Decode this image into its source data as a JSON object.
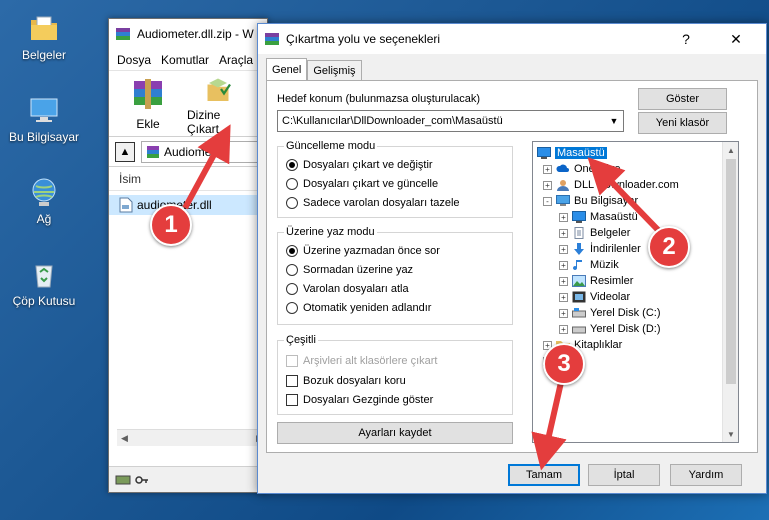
{
  "desktop": {
    "icons": [
      {
        "label": "Belgeler",
        "icon": "documents-folder-icon"
      },
      {
        "label": "Bu Bilgisayar",
        "icon": "computer-icon"
      },
      {
        "label": "Ağ",
        "icon": "network-icon"
      },
      {
        "label": "Çöp Kutusu",
        "icon": "recycle-bin-icon"
      }
    ]
  },
  "winrar": {
    "title": "Audiometer.dll.zip - W",
    "menu": [
      "Dosya",
      "Komutlar",
      "Araçla"
    ],
    "toolbar": {
      "add_label": "Ekle",
      "extract_label": "Dizine Çıkart"
    },
    "path": "Audiometer",
    "list_header": "İsim",
    "file_name": "audiometer.dll"
  },
  "dialog": {
    "title": "Çıkartma yolu ve seçenekleri",
    "close": "✕",
    "help": "?",
    "tabs": [
      {
        "label": "Genel",
        "active": true
      },
      {
        "label": "Gelişmiş",
        "active": false
      }
    ],
    "destination_label": "Hedef konum (bulunmazsa oluşturulacak)",
    "destination_value": "C:\\Kullanıcılar\\DllDownloader_com\\Masaüstü",
    "show_button": "Göster",
    "new_folder_button": "Yeni klasör",
    "update_mode": {
      "title": "Güncelleme modu",
      "options": [
        {
          "label": "Dosyaları çıkart ve değiştir",
          "selected": true
        },
        {
          "label": "Dosyaları çıkart ve güncelle",
          "selected": false
        },
        {
          "label": "Sadece varolan dosyaları tazele",
          "selected": false
        }
      ]
    },
    "overwrite_mode": {
      "title": "Üzerine yaz modu",
      "options": [
        {
          "label": "Üzerine yazmadan önce sor",
          "selected": true
        },
        {
          "label": "Sormadan üzerine yaz",
          "selected": false
        },
        {
          "label": "Varolan dosyaları atla",
          "selected": false
        },
        {
          "label": "Otomatik yeniden adlandır",
          "selected": false
        }
      ]
    },
    "misc": {
      "title": "Çeşitli",
      "options": [
        {
          "label": "Arşivleri alt klasörlere çıkart",
          "checked": false,
          "disabled": true
        },
        {
          "label": "Bozuk dosyaları koru",
          "checked": false,
          "disabled": false
        },
        {
          "label": "Dosyaları Gezginde göster",
          "checked": false,
          "disabled": false
        }
      ]
    },
    "save_settings_button": "Ayarları kaydet",
    "tree": [
      {
        "label": "Masaüstü",
        "level": 0,
        "expander": "",
        "icon": "desktop-icon",
        "selected": true
      },
      {
        "label": "OneDrive",
        "level": 1,
        "expander": "+",
        "icon": "onedrive-icon",
        "selected": false
      },
      {
        "label": "DLL Downloader.com",
        "level": 1,
        "expander": "+",
        "icon": "user-icon",
        "selected": false
      },
      {
        "label": "Bu Bilgisayar",
        "level": 1,
        "expander": "-",
        "icon": "computer-icon",
        "selected": false
      },
      {
        "label": "Masaüstü",
        "level": 2,
        "expander": "+",
        "icon": "desktop-icon",
        "selected": false
      },
      {
        "label": "Belgeler",
        "level": 2,
        "expander": "+",
        "icon": "documents-icon",
        "selected": false
      },
      {
        "label": "İndirilenler",
        "level": 2,
        "expander": "+",
        "icon": "download-icon",
        "selected": false
      },
      {
        "label": "Müzik",
        "level": 2,
        "expander": "+",
        "icon": "music-icon",
        "selected": false
      },
      {
        "label": "Resimler",
        "level": 2,
        "expander": "+",
        "icon": "pictures-icon",
        "selected": false
      },
      {
        "label": "Videolar",
        "level": 2,
        "expander": "+",
        "icon": "videos-icon",
        "selected": false
      },
      {
        "label": "Yerel Disk (C:)",
        "level": 2,
        "expander": "+",
        "icon": "drive-icon",
        "selected": false
      },
      {
        "label": "Yerel Disk (D:)",
        "level": 2,
        "expander": "+",
        "icon": "drive-icon",
        "selected": false
      },
      {
        "label": "Kitaplıklar",
        "level": 1,
        "expander": "+",
        "icon": "libraries-icon",
        "selected": false
      },
      {
        "label": "",
        "level": 1,
        "expander": "+",
        "icon": "network-icon",
        "selected": false
      }
    ],
    "ok_button": "Tamam",
    "cancel_button": "İptal",
    "help_button": "Yardım"
  },
  "annotations": {
    "markers": [
      "1",
      "2",
      "3"
    ],
    "color": "#e43d3d"
  }
}
